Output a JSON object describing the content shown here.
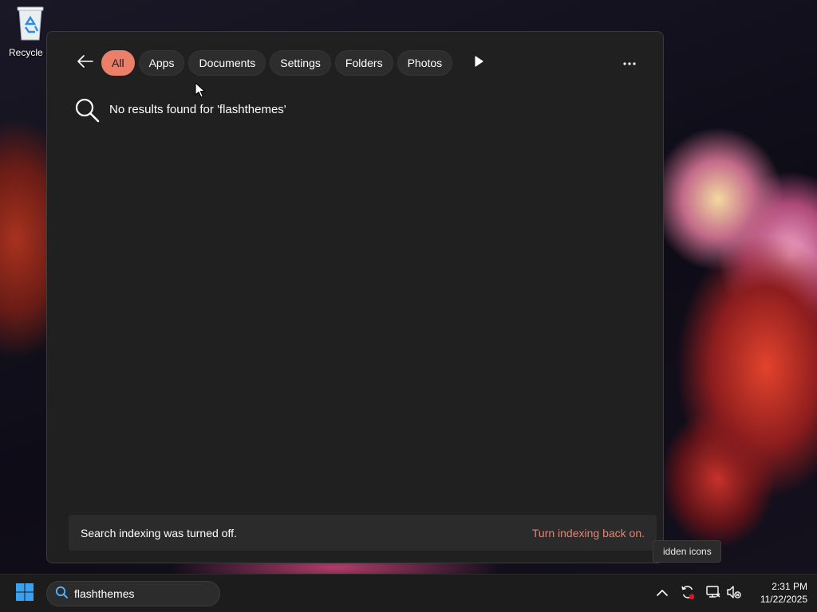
{
  "desktop": {
    "recycle_bin_label": "Recycle B"
  },
  "search_flyout": {
    "filters": [
      "All",
      "Apps",
      "Documents",
      "Settings",
      "Folders",
      "Photos"
    ],
    "active_filter": "All",
    "no_results_message": "No results found for 'flashthemes'",
    "indexing_notice": "Search indexing was turned off.",
    "indexing_link": "Turn indexing back on."
  },
  "tooltip": {
    "text": "idden icons"
  },
  "taskbar": {
    "search_query": "flashthemes",
    "clock": {
      "time": "2:31 PM",
      "date": "11/22/2025"
    }
  },
  "colors": {
    "accent": "#ec7f6a",
    "link": "#e8826e",
    "panel": "#202020",
    "taskbar": "#1c1c1c"
  },
  "icons": {
    "back": "arrow-left-icon",
    "more_filters": "play-icon",
    "options": "ellipsis-icon",
    "no_results": "search-icon",
    "start": "windows-logo-icon",
    "tray": [
      "chevron-up-icon",
      "sync-icon",
      "network-icon",
      "volume-muted-icon"
    ]
  }
}
